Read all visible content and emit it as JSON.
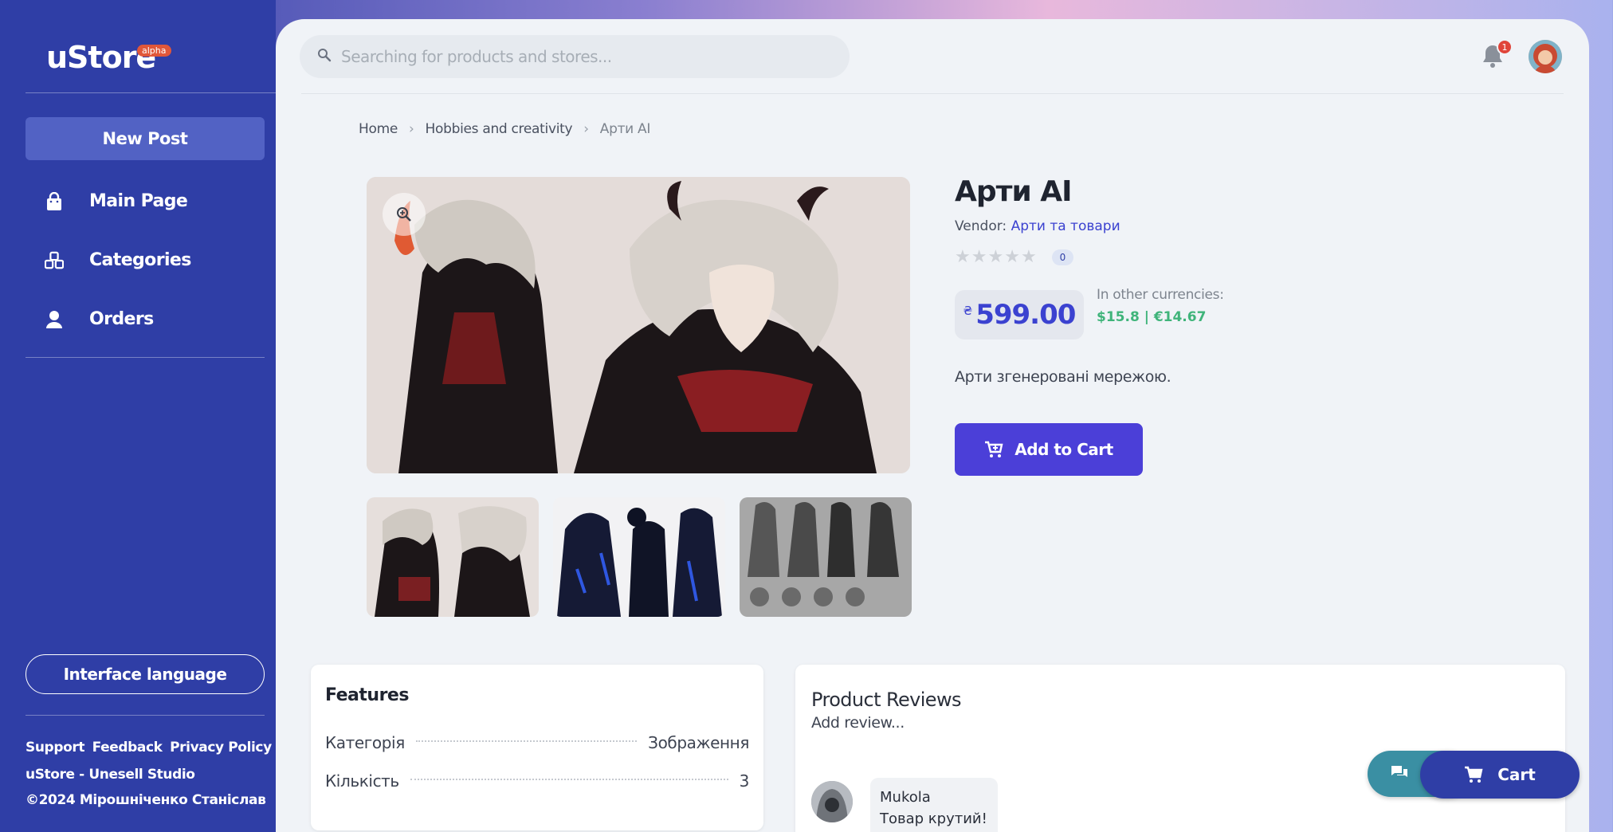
{
  "sidebar": {
    "logo": "uStore",
    "logo_badge": "alpha",
    "new_post": "New Post",
    "items": [
      {
        "label": "Main Page",
        "icon": "shopping-bag-icon"
      },
      {
        "label": "Categories",
        "icon": "cubes-icon"
      },
      {
        "label": "Orders",
        "icon": "user-icon"
      }
    ],
    "language_button": "Interface language",
    "footer_links": [
      "Support",
      "Feedback",
      "Privacy Policy"
    ],
    "footer_studio": "uStore - Unesell Studio",
    "footer_copyright": "©2024 Мірошніченко Станіслав"
  },
  "header": {
    "search_placeholder": "Searching for products and stores...",
    "notification_count": "1"
  },
  "breadcrumb": [
    "Home",
    "Hobbies and creativity",
    "Арти AI"
  ],
  "product": {
    "title": "Арти AI",
    "vendor_label": "Vendor:",
    "vendor_name": "Арти та товари",
    "rating_count": "0",
    "currency_symbol": "₴",
    "price": "599.00",
    "other_currencies_label": "In other currencies:",
    "other_currencies_value": "$15.8 | €14.67",
    "description": "Арти згенеровані мережою.",
    "add_to_cart": "Add to Cart"
  },
  "features": {
    "title": "Features",
    "rows": [
      {
        "key": "Категорія",
        "value": "Зображення"
      },
      {
        "key": "Кількість",
        "value": "3"
      }
    ]
  },
  "reviews": {
    "title": "Product Reviews",
    "add_review": "Add review...",
    "items": [
      {
        "author": "Mukola",
        "text": "Товар крутий!"
      }
    ]
  },
  "floating": {
    "cart_label": "Cart"
  },
  "colors": {
    "sidebar": "#2f3ea6",
    "accent": "#4b3fd8",
    "price": "#3b42d0",
    "green": "#3fb47a"
  }
}
